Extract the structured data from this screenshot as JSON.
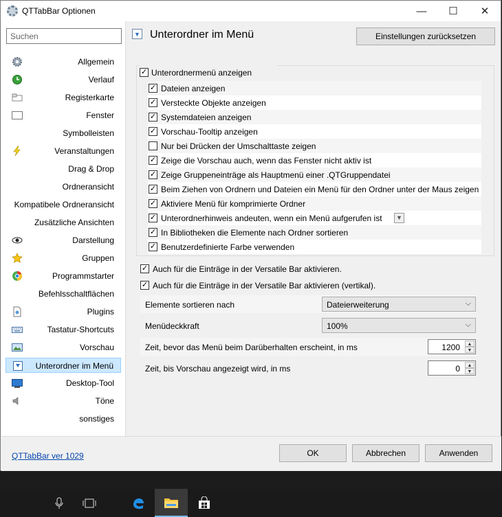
{
  "window": {
    "title": "QTTabBar Optionen",
    "controls": {
      "minimize": "—",
      "maximize": "☐",
      "close": "✕"
    }
  },
  "sidebar": {
    "search_placeholder": "Suchen",
    "items": [
      {
        "label": "Allgemein",
        "icon": "gear-icon"
      },
      {
        "label": "Verlauf",
        "icon": "history-icon"
      },
      {
        "label": "Registerkarte",
        "icon": "tab-icon"
      },
      {
        "label": "Fenster",
        "icon": "window-icon"
      },
      {
        "label": "Symbolleisten",
        "icon": ""
      },
      {
        "label": "Veranstaltungen",
        "icon": "lightning-icon"
      },
      {
        "label": "Drag & Drop",
        "icon": ""
      },
      {
        "label": "Ordneransicht",
        "icon": ""
      },
      {
        "label": "Kompatibele Ordneransicht",
        "icon": ""
      },
      {
        "label": "Zusätzliche Ansichten",
        "icon": ""
      },
      {
        "label": "Darstellung",
        "icon": "eye-icon"
      },
      {
        "label": "Gruppen",
        "icon": "star-icon"
      },
      {
        "label": "Programmstarter",
        "icon": "launcher-icon"
      },
      {
        "label": "Befehlsschaltflächen",
        "icon": ""
      },
      {
        "label": "Plugins",
        "icon": "plugin-icon"
      },
      {
        "label": "Tastatur-Shortcuts",
        "icon": "keyboard-icon"
      },
      {
        "label": "Vorschau",
        "icon": "preview-icon"
      },
      {
        "label": "Unterordner im Menü",
        "icon": "down-arrow-icon"
      },
      {
        "label": "Desktop-Tool",
        "icon": "desktop-icon"
      },
      {
        "label": "Töne",
        "icon": "speaker-icon"
      },
      {
        "label": "sonstiges",
        "icon": ""
      }
    ]
  },
  "main": {
    "title": "Unterordner im Menü",
    "reset_button": "Einstellungen zurücksetzen",
    "group_checkbox": "Unterordnermenü anzeigen",
    "options": [
      {
        "label": "Dateien anzeigen",
        "checked": true
      },
      {
        "label": "Versteckte Objekte anzeigen",
        "checked": true
      },
      {
        "label": "Systemdateien anzeigen",
        "checked": true
      },
      {
        "label": "Vorschau-Tooltip anzeigen",
        "checked": true
      },
      {
        "label": "Nur bei Drücken der Umschalttaste zeigen",
        "checked": false
      },
      {
        "label": "Zeige die Vorschau auch, wenn das Fenster nicht aktiv ist",
        "checked": true
      },
      {
        "label": "Zeige Gruppeneinträge als Hauptmenü einer .QTGruppendatei",
        "checked": true
      },
      {
        "label": "Beim Ziehen von Ordnern und Dateien ein Menü für den Ordner unter der Maus zeigen",
        "checked": true
      },
      {
        "label": "Aktiviere Menü für komprimierte Ordner",
        "checked": true
      },
      {
        "label": "Unterordnerhinweis andeuten, wenn ein Menü aufgerufen ist",
        "checked": true
      },
      {
        "label": "In Bibliotheken die Elemente nach Ordner sortieren",
        "checked": true
      },
      {
        "label": "Benutzerdefinierte Farbe verwenden",
        "checked": true
      }
    ],
    "versatile1": "Auch für die Einträge in der Versatile Bar aktivieren.",
    "versatile2": "Auch für die Einträge in der Versatile Bar aktivieren (vertikal).",
    "sort_label": "Elemente sortieren nach",
    "sort_value": "Dateierweiterung",
    "opacity_label": "Menüdeckkraft",
    "opacity_value": "100%",
    "hover_delay_label": "Zeit, bevor das Menü beim Darüberhalten erscheint, in ms",
    "hover_delay_value": "1200",
    "preview_delay_label": "Zeit, bis Vorschau angezeigt wird, in ms",
    "preview_delay_value": "0"
  },
  "footer": {
    "version": "QTTabBar ver 1029",
    "ok": "OK",
    "cancel": "Abbrechen",
    "apply": "Anwenden"
  },
  "taskbar": {
    "items": [
      "microphone-icon",
      "task-view-icon",
      "edge-icon",
      "explorer-icon",
      "store-icon"
    ]
  },
  "colors": {
    "selection_bg": "#cce8ff",
    "selection_border": "#99d1ff",
    "taskbar": "#1a1a1a",
    "link": "#0645ad"
  }
}
